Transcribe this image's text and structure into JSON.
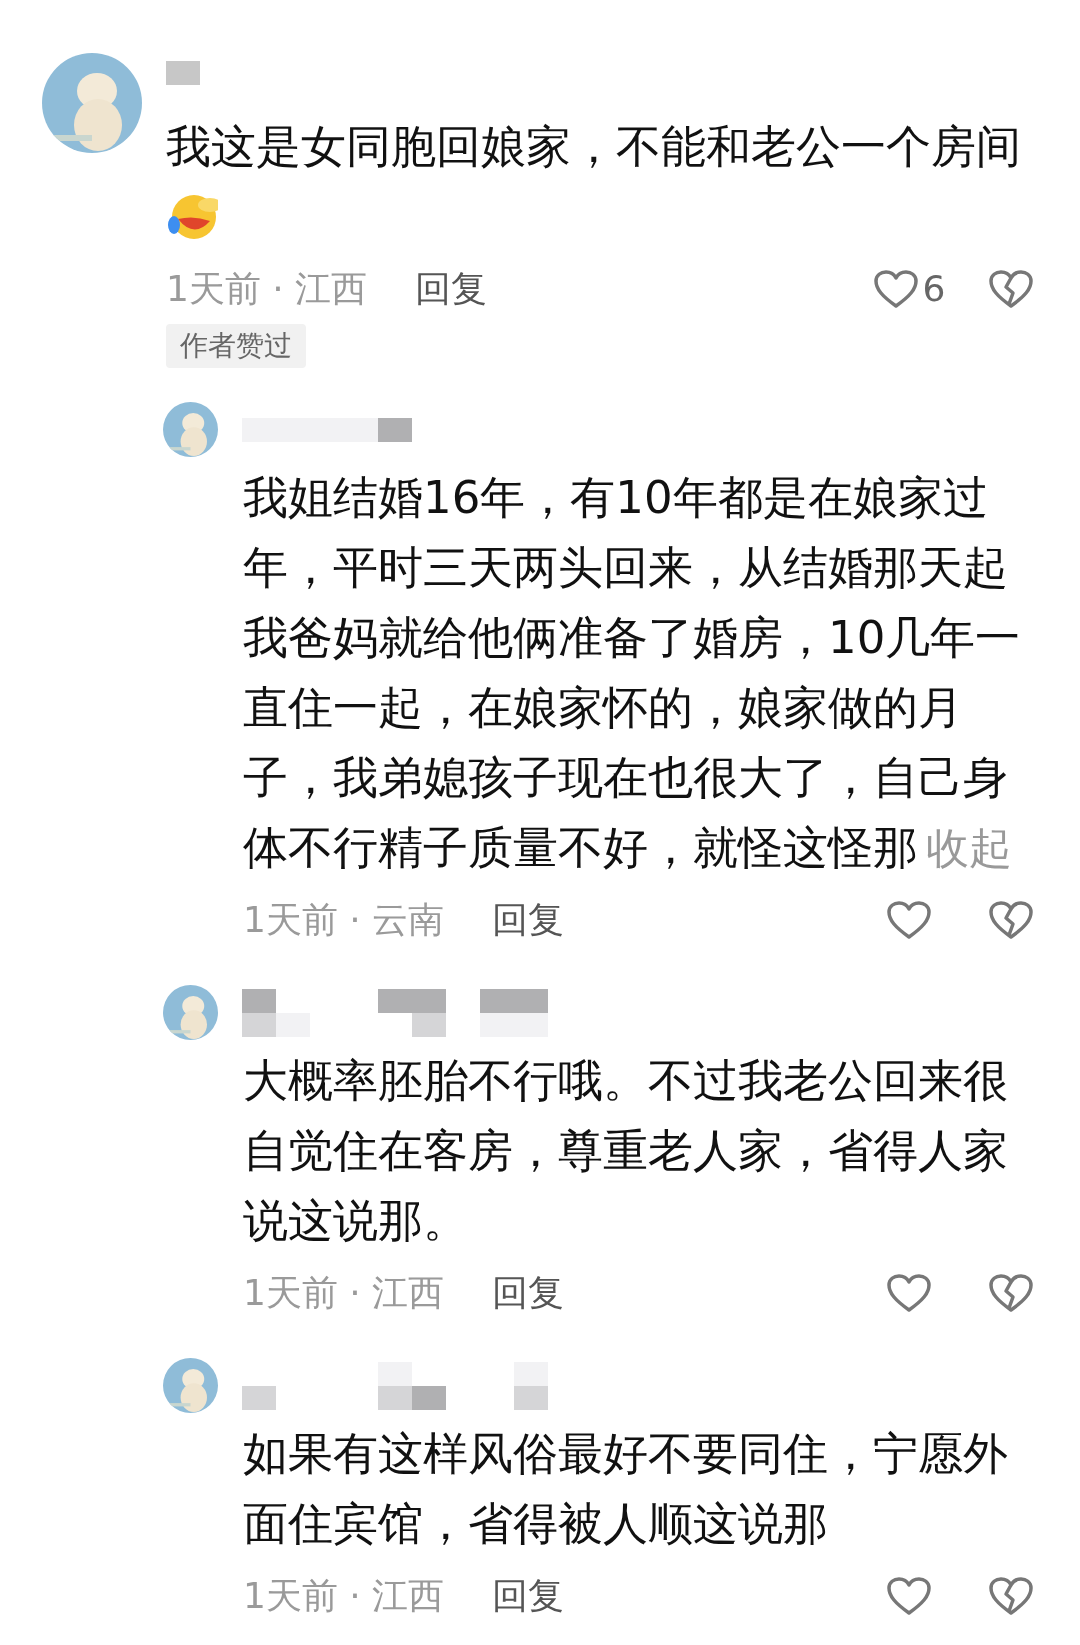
{
  "comments": [
    {
      "kind": "comment",
      "text": "我这是女同胞回娘家，不能和老公一个房间",
      "emoji": true,
      "meta": "1天前 · 江西",
      "reply": "回复",
      "likes": "6",
      "badge": "作者赞过"
    },
    {
      "kind": "reply",
      "text": "我姐结婚16年，有10年都是在娘家过年，平时三天两头回来，从结婚那天起我爸妈就给他俩准备了婚房，10几年一直住一起，在娘家怀的，娘家做的月子，我弟媳孩子现在也很大了，自己身体不行精子质量不好，就怪这怪那",
      "collapse": "收起",
      "meta": "1天前 · 云南",
      "reply": "回复"
    },
    {
      "kind": "reply",
      "text": "大概率胚胎不行哦。不过我老公回来很自觉住在客房，尊重老人家，省得人家说这说那。",
      "meta": "1天前 · 江西",
      "reply": "回复"
    },
    {
      "kind": "reply",
      "text": "如果有这样风俗最好不要同住，宁愿外面住宾馆，省得被人顺这说那",
      "meta": "1天前 · 江西",
      "reply": "回复"
    }
  ]
}
